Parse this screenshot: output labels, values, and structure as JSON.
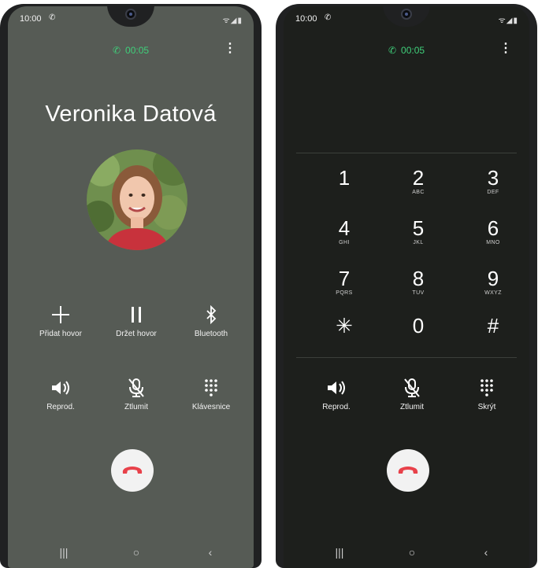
{
  "left": {
    "status": {
      "time": "10:00"
    },
    "timer": "00:05",
    "caller_name": "Veronika Datová",
    "controls": {
      "add_call": "Přidat hovor",
      "hold": "Držet hovor",
      "bluetooth": "Bluetooth",
      "speaker": "Reprod.",
      "mute": "Ztlumit",
      "keypad": "Klávesnice"
    }
  },
  "right": {
    "status": {
      "time": "10:00"
    },
    "timer": "00:05",
    "keys": [
      {
        "digit": "1",
        "letters": ""
      },
      {
        "digit": "2",
        "letters": "ABC"
      },
      {
        "digit": "3",
        "letters": "DEF"
      },
      {
        "digit": "4",
        "letters": "GHI"
      },
      {
        "digit": "5",
        "letters": "JKL"
      },
      {
        "digit": "6",
        "letters": "MNO"
      },
      {
        "digit": "7",
        "letters": "PQRS"
      },
      {
        "digit": "8",
        "letters": "TUV"
      },
      {
        "digit": "9",
        "letters": "WXYZ"
      },
      {
        "digit": "✳",
        "letters": ""
      },
      {
        "digit": "0",
        "letters": ""
      },
      {
        "digit": "#",
        "letters": ""
      }
    ],
    "controls": {
      "speaker": "Reprod.",
      "mute": "Ztlumit",
      "hide": "Skrýt"
    }
  },
  "colors": {
    "accent_green": "#3fcf7a",
    "end_call_red": "#e8414a"
  }
}
